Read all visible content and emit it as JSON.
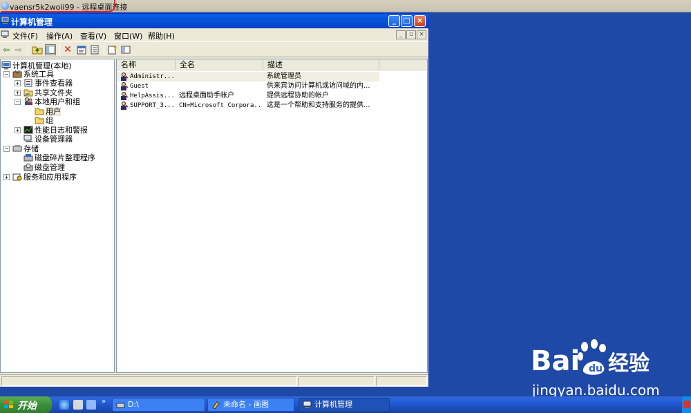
{
  "remote_window": {
    "title": "vaensr5k2woii99 - 远程桌面连接"
  },
  "app": {
    "title": "计算机管理",
    "caption_buttons": {
      "minimize": "_",
      "maximize": "□",
      "close": "×"
    },
    "menus": [
      {
        "label": "文件(F)"
      },
      {
        "label": "操作(A)"
      },
      {
        "label": "查看(V)"
      },
      {
        "label": "窗口(W)"
      },
      {
        "label": "帮助(H)"
      }
    ],
    "toolbar": [
      "back-icon",
      "forward-icon",
      "up-folder-icon",
      "show-tree-icon",
      "delete-icon",
      "properties-icon",
      "export-list-icon",
      "help-icon",
      "description-icon"
    ]
  },
  "tree": {
    "root": "计算机管理(本地)",
    "items": [
      {
        "label": "系统工具",
        "icon": "tools-icon"
      },
      {
        "label": "事件查看器",
        "icon": "event-viewer-icon"
      },
      {
        "label": "共享文件夹",
        "icon": "shared-folder-icon"
      },
      {
        "label": "本地用户和组",
        "icon": "users-groups-icon"
      },
      {
        "label": "用户",
        "icon": "folder-icon"
      },
      {
        "label": "组",
        "icon": "folder-icon"
      },
      {
        "label": "性能日志和警报",
        "icon": "performance-icon"
      },
      {
        "label": "设备管理器",
        "icon": "device-manager-icon"
      },
      {
        "label": "存储",
        "icon": "storage-icon"
      },
      {
        "label": "磁盘碎片整理程序",
        "icon": "defrag-icon"
      },
      {
        "label": "磁盘管理",
        "icon": "disk-management-icon"
      },
      {
        "label": "服务和应用程序",
        "icon": "services-icon"
      }
    ]
  },
  "list": {
    "columns": [
      "名称",
      "全名",
      "描述"
    ],
    "rows": [
      {
        "name": "Administr...",
        "fullname": "",
        "desc": "系统管理员"
      },
      {
        "name": "Guest",
        "fullname": "",
        "desc": "供来宾访问计算机或访问域的内..."
      },
      {
        "name": "HelpAssis...",
        "fullname": "远程桌面助手帐户",
        "desc": "提供远程协助的帐户"
      },
      {
        "name": "SUPPORT_3...",
        "fullname": "CN=Microsoft Corpora...",
        "desc": "这是一个帮助和支持服务的提供..."
      }
    ]
  },
  "watermark": {
    "brand": "Bai",
    "brand_cn": "经验",
    "site": "jingyan.baidu.com"
  },
  "taskbar": {
    "start": "开始",
    "more": "»",
    "tasks": [
      {
        "label": "D:\\"
      },
      {
        "label": "未命名 - 画图"
      },
      {
        "label": "计算机管理"
      }
    ]
  },
  "colors": {
    "title_bar": "#0a5fe6",
    "desktop": "#1e49a6",
    "highlight_mark": "#e0202a",
    "taskbar": "#245edb",
    "start": "#3c8f3a"
  }
}
